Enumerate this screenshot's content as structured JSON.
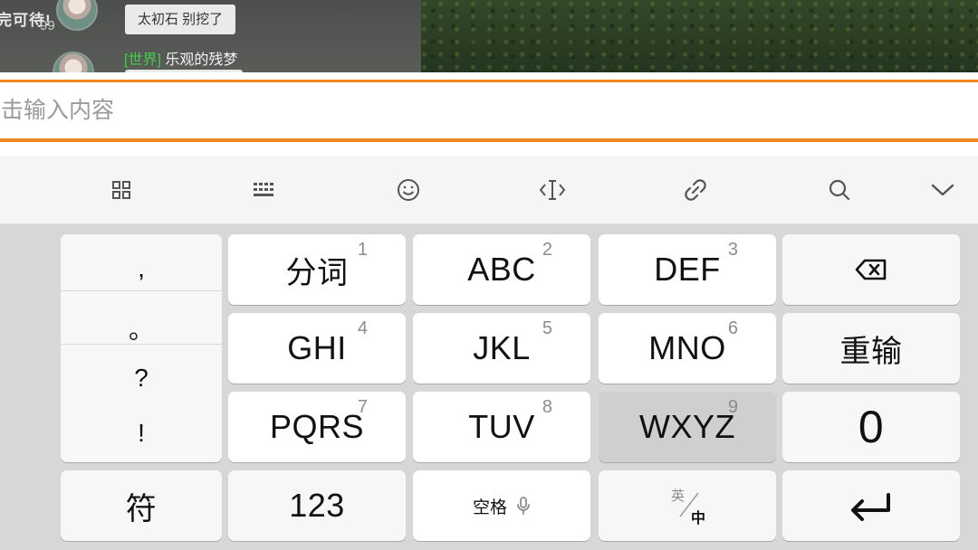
{
  "game_chat": {
    "clipped_text": "完可待!",
    "level_badge": "99",
    "message_1": "太初石 别挖了",
    "message_2_tag": "[世界]",
    "message_2_name": "乐观的残梦"
  },
  "input": {
    "placeholder": "击输入内容",
    "value": ""
  },
  "toolbar": {
    "icons": [
      "apps-grid-icon",
      "keyboard-icon",
      "emoji-icon",
      "cursor-icon",
      "link-icon",
      "search-icon",
      "chevron-down-icon"
    ]
  },
  "keyboard": {
    "punctuation": [
      ",",
      "。",
      "?",
      "!"
    ],
    "keys": {
      "k1": {
        "label": "分词",
        "num": "1"
      },
      "k2": {
        "label": "ABC",
        "num": "2"
      },
      "k3": {
        "label": "DEF",
        "num": "3"
      },
      "k4": {
        "label": "GHI",
        "num": "4"
      },
      "k5": {
        "label": "JKL",
        "num": "5"
      },
      "k6": {
        "label": "MNO",
        "num": "6"
      },
      "k7": {
        "label": "PQRS",
        "num": "7"
      },
      "k8": {
        "label": "TUV",
        "num": "8"
      },
      "k9": {
        "label": "WXYZ",
        "num": "9"
      }
    },
    "reinput": "重输",
    "zero": "0",
    "symbols": "符",
    "numbers": "123",
    "space": "空格",
    "lang_top": "英",
    "lang_bottom": "中"
  },
  "colors": {
    "accent": "#f0861e",
    "chat_tag": "#3fd04a",
    "pressed_key": "#cfcfcf"
  }
}
